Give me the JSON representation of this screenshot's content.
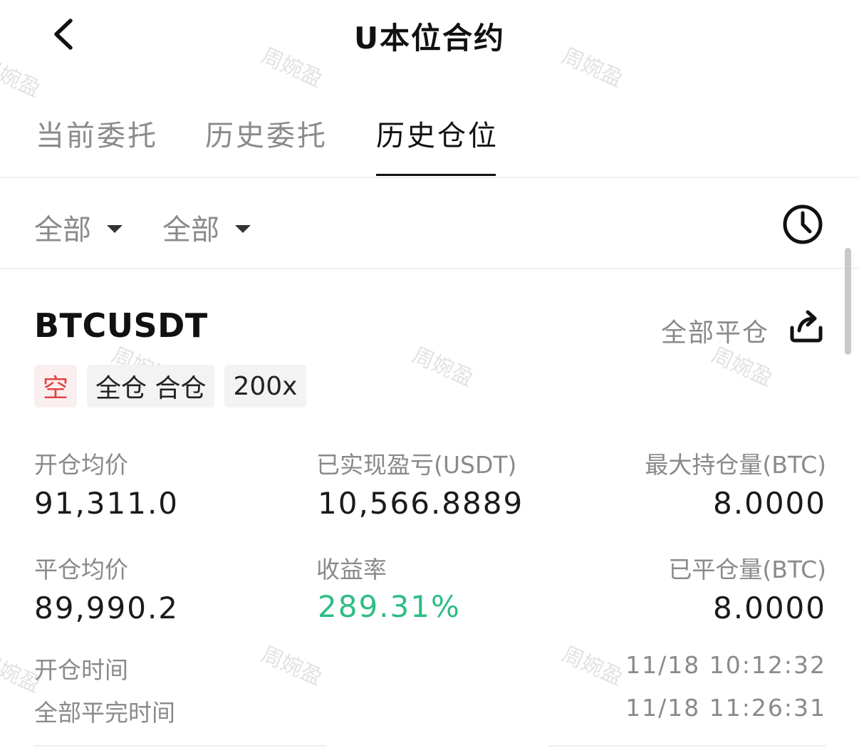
{
  "header": {
    "title": "U本位合约"
  },
  "tabs": [
    {
      "label": "当前委托",
      "active": false
    },
    {
      "label": "历史委托",
      "active": false
    },
    {
      "label": "历史仓位",
      "active": true
    }
  ],
  "filters": [
    {
      "label": "全部"
    },
    {
      "label": "全部"
    }
  ],
  "position": {
    "symbol": "BTCUSDT",
    "close_all_label": "全部平仓",
    "tags": {
      "side": "空",
      "margin_mode": "全仓 合仓",
      "leverage": "200x"
    },
    "stats": {
      "open_avg_price_label": "开仓均价",
      "open_avg_price": "91,311.0",
      "realized_pnl_label": "已实现盈亏(USDT)",
      "realized_pnl": "10,566.8889",
      "max_position_label": "最大持仓量(BTC)",
      "max_position": "8.0000",
      "close_avg_price_label": "平仓均价",
      "close_avg_price": "89,990.2",
      "roi_label": "收益率",
      "roi": "289.31%",
      "closed_amount_label": "已平仓量(BTC)",
      "closed_amount": "8.0000"
    },
    "times": {
      "open_time_label": "开仓时间",
      "open_time": "11/18 10:12:32",
      "close_time_label": "全部平完时间",
      "close_time": "11/18 11:26:31"
    }
  },
  "watermark": {
    "text": "周婉盈"
  },
  "colors": {
    "short_red": "#e04545",
    "profit_green": "#2ebd85",
    "muted_gray": "#8a8a8a"
  },
  "icons": {
    "back": "chevron-left-icon",
    "history": "clock-icon",
    "share": "share-icon",
    "dropdown": "caret-down-icon"
  }
}
